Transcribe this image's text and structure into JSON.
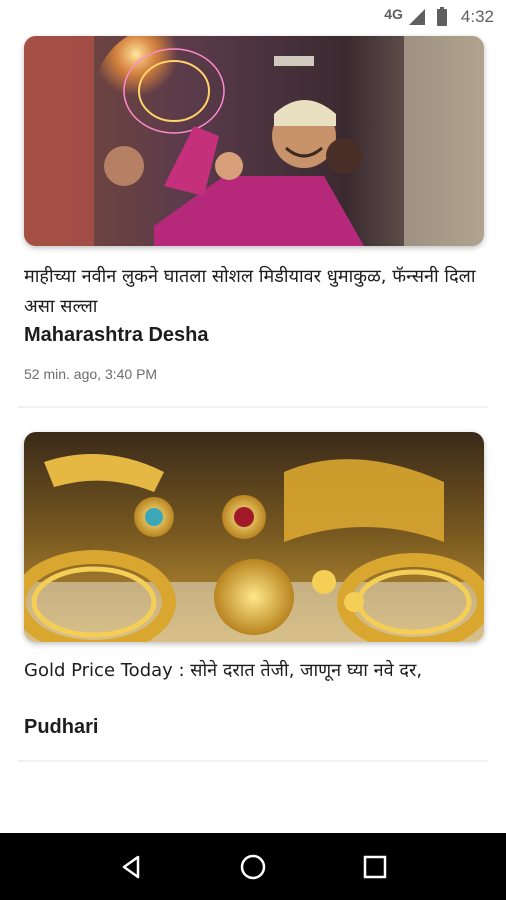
{
  "status_bar": {
    "network": "4G",
    "time": "4:32",
    "icons": [
      "signal-icon",
      "battery-icon"
    ]
  },
  "feed": {
    "articles": [
      {
        "image": "dhoni-new-look-photo",
        "headline": "माहीच्या नवीन लुकने घातला सोशल मिडीयावर धुमाकुळ, फॅन्सनी दिला असा सल्ला",
        "source": "Maharashtra Desha",
        "time": "52 min. ago, 3:40 PM"
      },
      {
        "image": "gold-jewellery-photo",
        "headline": "Gold Price Today : सोने दरात तेजी, जाणून घ्या नवे दर,",
        "source": "Pudhari"
      }
    ]
  },
  "nav_bar": {
    "buttons": [
      "back-icon",
      "home-icon",
      "recents-icon"
    ]
  },
  "colors": {
    "text": "#1d1d1d",
    "muted": "#6d6d6d",
    "nav_bg": "#000000"
  }
}
